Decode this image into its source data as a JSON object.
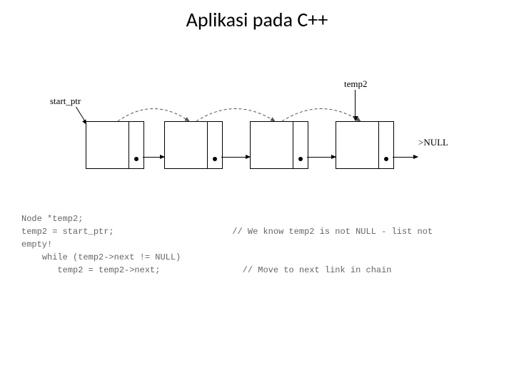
{
  "title": "Aplikasi pada C++",
  "diagram": {
    "start_ptr_label": "start_ptr",
    "temp2_label": "temp2",
    "null_label": ">NULL",
    "node_count": 4
  },
  "code": {
    "l1": "Node *temp2;",
    "l2": "temp2 = start_ptr;",
    "c2": "// We know temp2 is not NULL - list not",
    "l3": "empty!",
    "l4": "while (temp2->next != NULL)",
    "l5": "   temp2 = temp2->next;",
    "c5": "// Move to next link in chain"
  }
}
